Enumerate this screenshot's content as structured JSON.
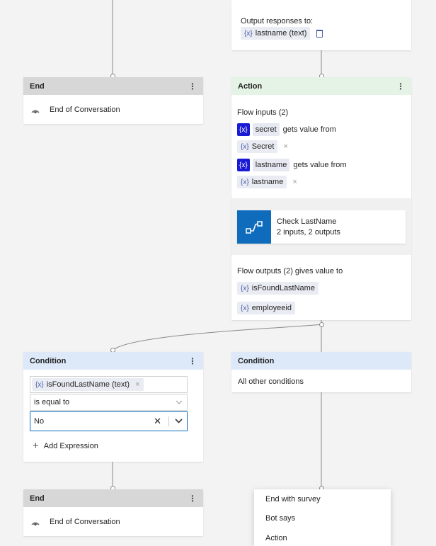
{
  "top_card": {
    "output_label": "Output responses to:",
    "var_chip": "lastname (text)"
  },
  "end_card_1": {
    "title": "End",
    "item": "End of Conversation"
  },
  "action_card": {
    "title": "Action",
    "flow_inputs": "Flow inputs (2)",
    "inputs": [
      {
        "var": "secret",
        "gets": "gets value from",
        "source": "Secret"
      },
      {
        "var": "lastname",
        "gets": "gets value from",
        "source": "lastname"
      }
    ],
    "flow": {
      "name": "Check LastName",
      "desc": "2 inputs, 2 outputs"
    },
    "flow_outputs": "Flow outputs (2) gives value to",
    "outputs": [
      "isFoundLastName",
      "employeeid"
    ]
  },
  "condition_card_1": {
    "title": "Condition",
    "var_chip": "isFoundLastName (text)",
    "operator": "is equal to",
    "value": "No",
    "add_expression": "Add Expression"
  },
  "condition_card_2": {
    "title": "Condition",
    "text": "All other conditions"
  },
  "end_card_2": {
    "title": "End",
    "item": "End of Conversation"
  },
  "add_menu": {
    "items": [
      "End with survey",
      "Bot says",
      "Action"
    ]
  },
  "icons": {
    "variable": "{x}",
    "close": "×",
    "chevron": "⌄",
    "plus": "+",
    "kebab": "⋮"
  }
}
